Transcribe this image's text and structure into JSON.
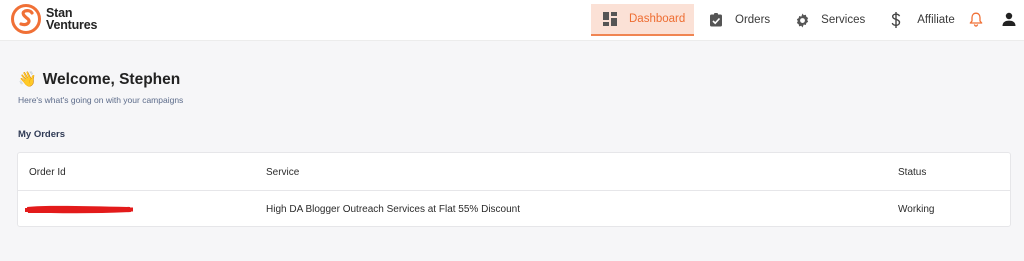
{
  "brand": {
    "line1": "Stan",
    "line2": "Ventures",
    "accent": "#f07036"
  },
  "nav": {
    "items": [
      {
        "label": "Dashboard",
        "icon": "dashboard-grid-icon",
        "active": true
      },
      {
        "label": "Orders",
        "icon": "clipboard-check-icon",
        "active": false
      },
      {
        "label": "Services",
        "icon": "gear-icon",
        "active": false
      },
      {
        "label": "Affiliate",
        "icon": "dollar-icon",
        "active": false
      }
    ],
    "notification_icon": "bell-icon",
    "user_icon": "user-icon"
  },
  "welcome": {
    "emoji": "👋",
    "title": "Welcome, Stephen",
    "subtitle": "Here's what's going on with your campaigns"
  },
  "orders": {
    "section_title": "My Orders",
    "columns": [
      "Order Id",
      "Service",
      "Status"
    ],
    "rows": [
      {
        "order_id": "",
        "order_id_redacted": true,
        "service": "High DA Blogger Outreach Services at Flat 55% Discount",
        "status": "Working"
      }
    ]
  },
  "colors": {
    "active_tab_bg": "#fbe1d6",
    "active_tab_text": "#ee6d32",
    "redaction": "#e31b1b"
  }
}
